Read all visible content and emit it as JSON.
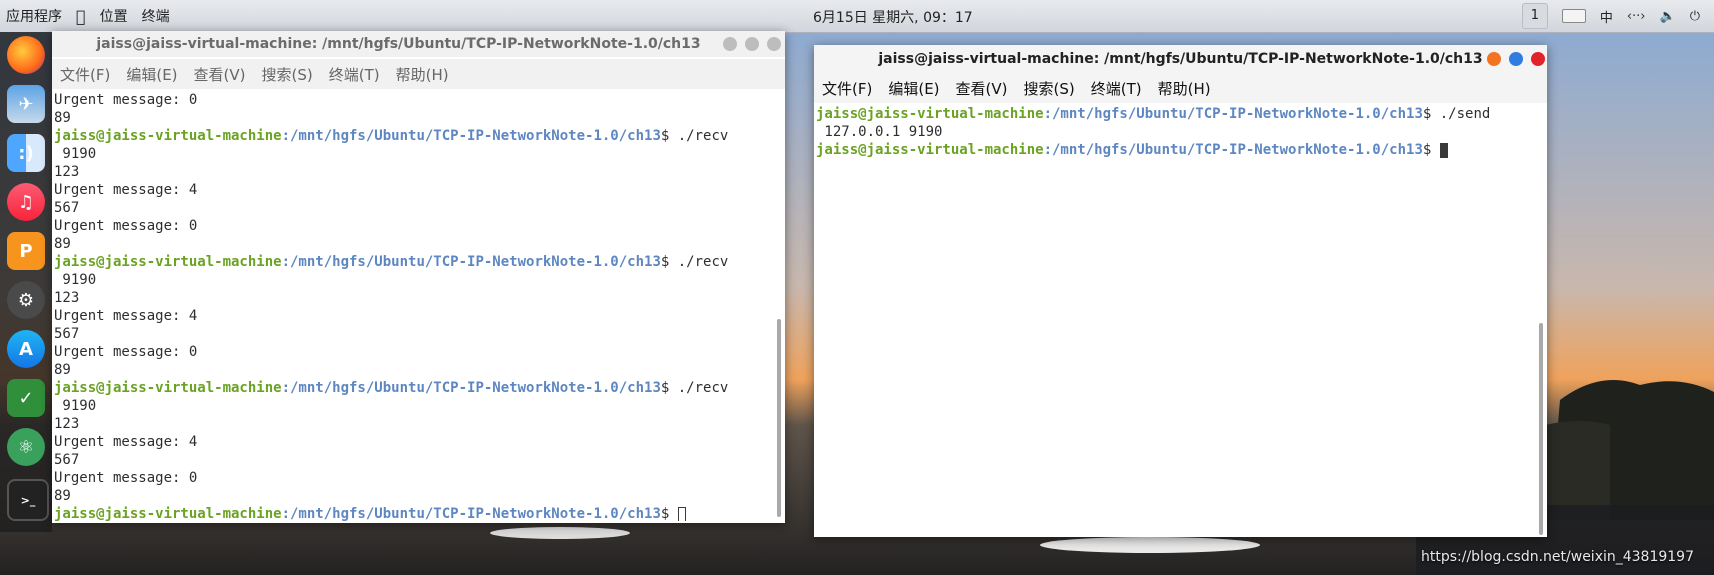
{
  "topbar": {
    "apps_label": "应用程序",
    "places_label": "位置",
    "terminal_label": "终端",
    "clock": "6月15日 星期六, 09：17",
    "workspace": "1",
    "ime": "中"
  },
  "dock": {
    "items": [
      "firefox-icon",
      "photo-app-icon",
      "finder-icon",
      "music-icon",
      "presentation-icon",
      "settings-icon",
      "app-store-icon",
      "vim-icon",
      "atom-icon",
      "terminal-icon"
    ]
  },
  "window_left": {
    "title": "jaiss@jaiss-virtual-machine: /mnt/hgfs/Ubuntu/TCP-IP-NetworkNote-1.0/ch13",
    "menu": [
      "文件(F)",
      "编辑(E)",
      "查看(V)",
      "搜索(S)",
      "终端(T)",
      "帮助(H)"
    ],
    "lines": [
      {
        "t": "Urgent message: 0"
      },
      {
        "t": "89"
      },
      {
        "p": true,
        "cmd": " ./recv"
      },
      {
        "t": " 9190"
      },
      {
        "t": "123"
      },
      {
        "t": "Urgent message: 4"
      },
      {
        "t": "567"
      },
      {
        "t": "Urgent message: 0"
      },
      {
        "t": "89"
      },
      {
        "p": true,
        "cmd": " ./recv"
      },
      {
        "t": " 9190"
      },
      {
        "t": "123"
      },
      {
        "t": "Urgent message: 4"
      },
      {
        "t": "567"
      },
      {
        "t": "Urgent message: 0"
      },
      {
        "t": "89"
      },
      {
        "p": true,
        "cmd": " ./recv"
      },
      {
        "t": " 9190"
      },
      {
        "t": "123"
      },
      {
        "t": "Urgent message: 4"
      },
      {
        "t": "567"
      },
      {
        "t": "Urgent message: 0"
      },
      {
        "t": "89"
      },
      {
        "p": true,
        "cmd": " ",
        "cursor": "hollow"
      }
    ]
  },
  "window_right": {
    "title": "jaiss@jaiss-virtual-machine: /mnt/hgfs/Ubuntu/TCP-IP-NetworkNote-1.0/ch13",
    "menu": [
      "文件(F)",
      "编辑(E)",
      "查看(V)",
      "搜索(S)",
      "终端(T)",
      "帮助(H)"
    ],
    "lines": [
      {
        "p": true,
        "cmd": " ./send"
      },
      {
        "t": " 127.0.0.1 9190"
      },
      {
        "p": true,
        "cmd": " ",
        "cursor": "filled"
      }
    ]
  },
  "prompt": {
    "user_host": "jaiss@jaiss-virtual-machine",
    "path": ":/mnt/hgfs/Ubuntu/TCP-IP-NetworkNote-1.0/ch13",
    "dollar": "$"
  },
  "watermark": "https://blog.csdn.net/weixin_43819197",
  "colors": {
    "prompt_user": "#6aa222",
    "prompt_path": "#5e87c1",
    "btn_orange": "#f27321",
    "btn_blue": "#2f7de1",
    "btn_red": "#e0242a"
  }
}
